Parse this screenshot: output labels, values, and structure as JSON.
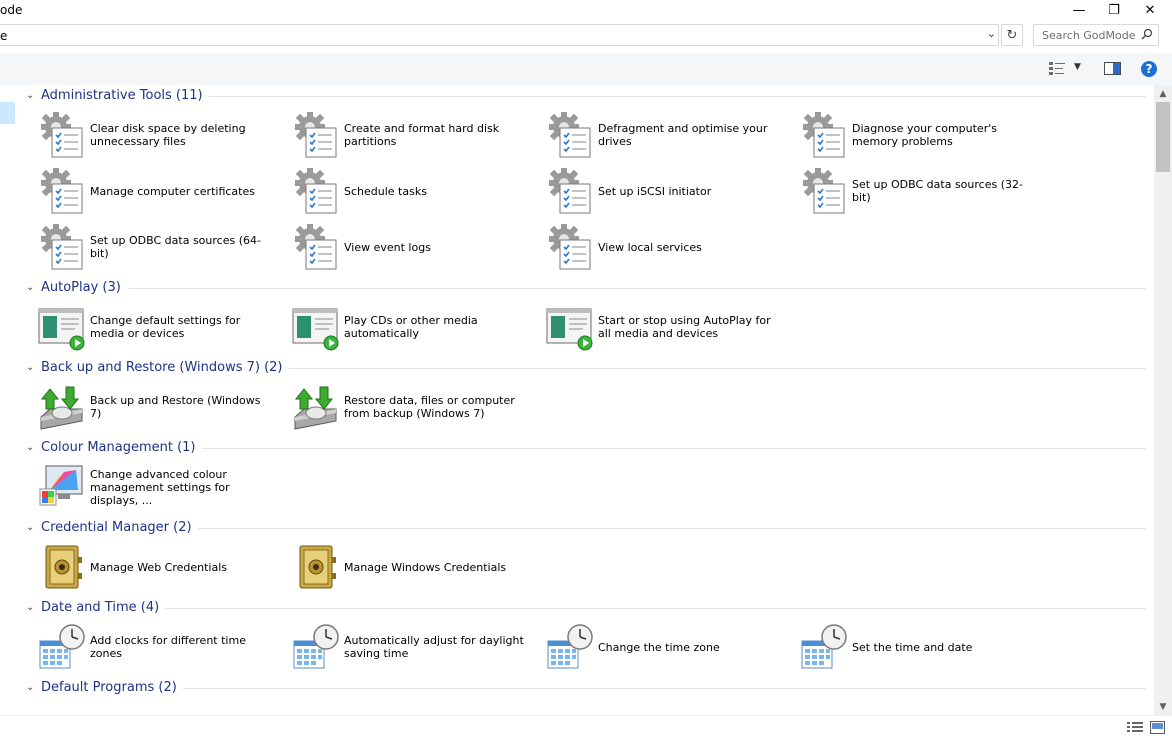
{
  "window": {
    "title": "ode",
    "minimize": "—",
    "restore": "❐",
    "close": "✕"
  },
  "address": {
    "path": "e",
    "dropdown": "⌄",
    "refresh": "↻"
  },
  "search": {
    "placeholder": "Search GodMode",
    "icon": "search-icon"
  },
  "toolbar": {
    "layout_dropdown": "▼",
    "help": "?"
  },
  "groups": [
    {
      "title": "Administrative Tools (11)",
      "icon": "admin-tools",
      "items": [
        "Clear disk space by deleting unnecessary files",
        "Create and format hard disk partitions",
        "Defragment and optimise your drives",
        "Diagnose your computer's memory problems",
        "Manage computer certificates",
        "Schedule tasks",
        "Set up iSCSI initiator",
        "Set up ODBC data sources (32-bit)",
        "Set up ODBC data sources (64-bit)",
        "View event logs",
        "View local services"
      ]
    },
    {
      "title": "AutoPlay (3)",
      "icon": "autoplay",
      "items": [
        "Change default settings for media or devices",
        "Play CDs or other media automatically",
        "Start or stop using AutoPlay for all media and devices"
      ]
    },
    {
      "title": "Back up and Restore (Windows 7) (2)",
      "icon": "backup",
      "items": [
        "Back up and Restore (Windows 7)",
        "Restore data, files or computer from backup (Windows 7)"
      ]
    },
    {
      "title": "Colour Management (1)",
      "icon": "colour",
      "items": [
        "Change advanced colour management settings for displays, ..."
      ]
    },
    {
      "title": "Credential Manager (2)",
      "icon": "credential",
      "items": [
        "Manage Web Credentials",
        "Manage Windows Credentials"
      ]
    },
    {
      "title": "Date and Time (4)",
      "icon": "clock",
      "items": [
        "Add clocks for different time zones",
        "Automatically adjust for daylight saving time",
        "Change the time zone",
        "Set the time and date"
      ]
    },
    {
      "title": "Default Programs (2)",
      "icon": "default-programs",
      "items": []
    }
  ],
  "colors": {
    "group_title": "#1e3287",
    "selection": "#cce8ff",
    "help": "#1a6fd4"
  }
}
